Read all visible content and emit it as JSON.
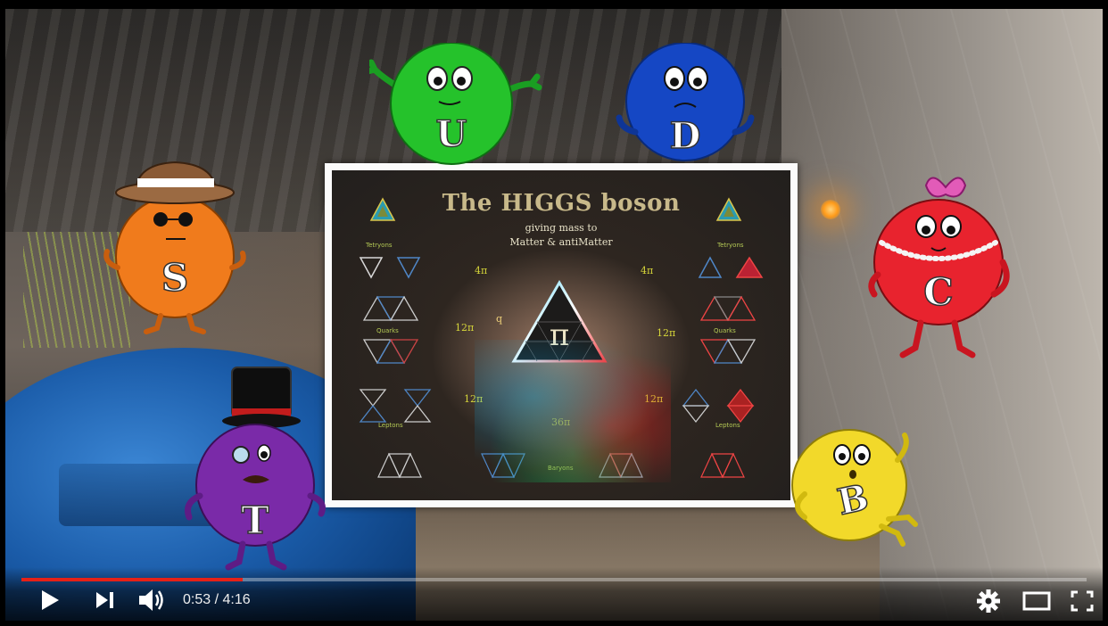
{
  "player": {
    "progress_fraction": 0.208,
    "progress_color": "#e62117",
    "time_current": "0:53",
    "time_separator": " / ",
    "time_total": "4:16",
    "controls": {
      "play_icon": "play-icon",
      "next_icon": "next-icon",
      "volume_icon": "volume-icon",
      "settings_icon": "gear-icon",
      "theater_icon": "theater-mode-icon",
      "fullscreen_icon": "fullscreen-icon"
    }
  },
  "poster": {
    "title": "The HIGGS boson",
    "subtitle_line1": "giving mass to",
    "subtitle_line2": "Matter & antiMatter",
    "left_tetryons": "Tetryons",
    "right_tetryons": "Tetryons",
    "left_quarks": "Quarks",
    "right_quarks": "Quarks",
    "left_leptons": "Leptons",
    "right_leptons": "Leptons",
    "baryons": "Baryons",
    "left_4pi": "4π",
    "right_4pi": "4π",
    "left_12pi_a": "12π",
    "right_12pi_a": "12π",
    "left_12pi_b": "12π",
    "right_12pi_b": "12π",
    "center_36pi": "36π",
    "q_label": "q",
    "pi_symbol": "π"
  },
  "characters": [
    {
      "letter": "U",
      "color": "#25c22b"
    },
    {
      "letter": "D",
      "color": "#1547c4"
    },
    {
      "letter": "S",
      "color": "#f07b1c"
    },
    {
      "letter": "C",
      "color": "#e8232e"
    },
    {
      "letter": "T",
      "color": "#7a2aa8"
    },
    {
      "letter": "B",
      "color": "#f2d92a"
    }
  ]
}
